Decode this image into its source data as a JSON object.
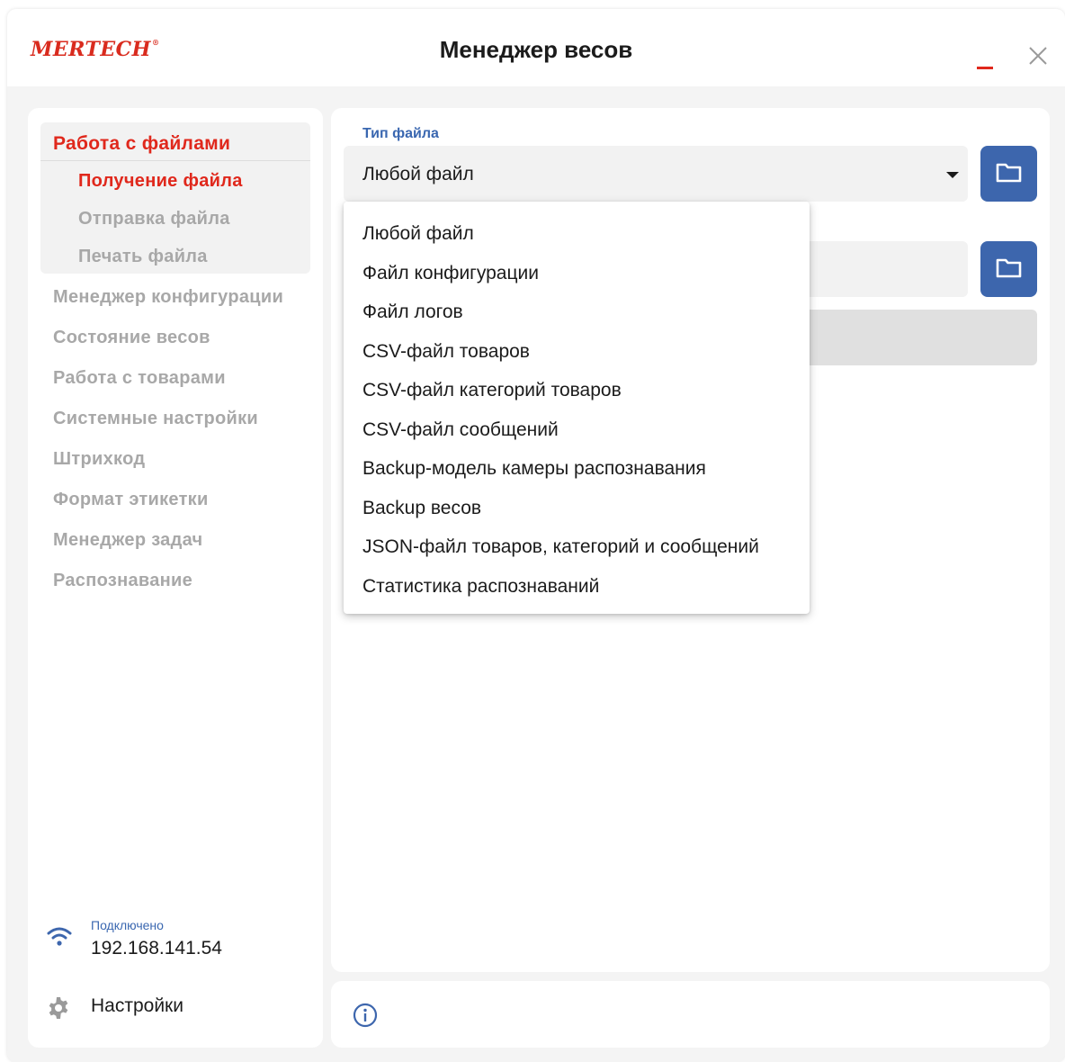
{
  "app": {
    "logo": "MERTECH",
    "logo_mark": "®",
    "title": "Менеджер весов"
  },
  "window_controls": {
    "minimize_icon": "minimize-icon",
    "close_icon": "close-icon",
    "accent_color": "#e0281c"
  },
  "sidebar": {
    "group": {
      "title": "Работа с файлами",
      "items": [
        {
          "label": "Получение файла",
          "active": true
        },
        {
          "label": "Отправка файла",
          "active": false
        },
        {
          "label": "Печать файла",
          "active": false
        }
      ]
    },
    "items": [
      {
        "label": "Менеджер конфигурации"
      },
      {
        "label": "Состояние весов"
      },
      {
        "label": "Работа с товарами"
      },
      {
        "label": "Системные настройки"
      },
      {
        "label": "Штрихкод"
      },
      {
        "label": "Формат этикетки"
      },
      {
        "label": "Менеджер задач"
      },
      {
        "label": "Распознавание"
      }
    ],
    "connection": {
      "status": "Подключено",
      "ip": "192.168.141.54",
      "icon": "wifi-icon"
    },
    "settings": {
      "label": "Настройки",
      "icon": "gear-icon"
    }
  },
  "main": {
    "file_type": {
      "label": "Тип файла",
      "value": "Любой файл",
      "options": [
        "Любой файл",
        "Файл конфигурации",
        "Файл логов",
        "CSV-файл товаров",
        "CSV-файл категорий товаров",
        "CSV-файл сообщений",
        "Backup-модель камеры распознавания",
        "Backup весов",
        "JSON-файл товаров, категорий и сообщений",
        "Статистика распознаваний"
      ]
    },
    "folder_icon": "folder-icon",
    "button_color": "#3d66ad"
  },
  "footer": {
    "info_icon": "info-icon"
  }
}
